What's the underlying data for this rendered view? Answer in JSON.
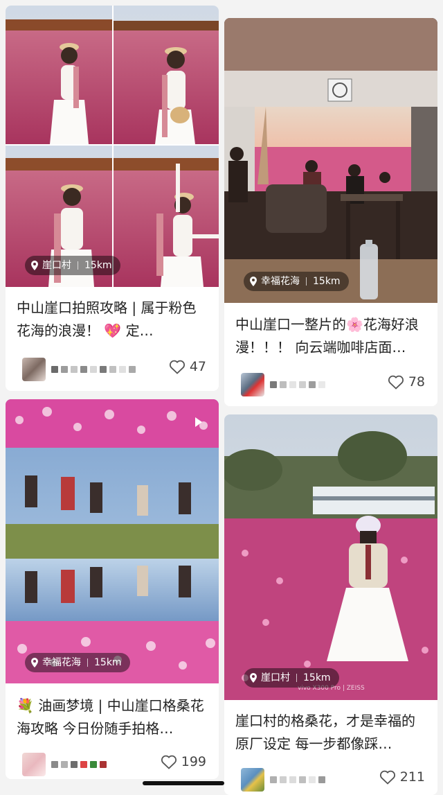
{
  "cards": [
    {
      "location": "崖口村",
      "distance": "15km",
      "title": "中山崖口拍照攻略 | 属于粉色花海的浪漫！ 💖 定…",
      "likes": "47"
    },
    {
      "location": "幸福花海",
      "distance": "15km",
      "title": "中山崖口一整片的🌸花海好浪漫！！！ 向云端咖啡店面…",
      "likes": "78"
    },
    {
      "location": "幸福花海",
      "distance": "15km",
      "title": "💐 油画梦境 | 中山崖口格桑花海攻略 今日份随手拍格…",
      "likes": "199"
    },
    {
      "location": "崖口村",
      "distance": "15km",
      "title": "崖口村的格桑花，才是幸福的原厂设定 每一步都像踩…",
      "likes": "211",
      "watermark": "vivo X300 Pro | ZEISS"
    }
  ],
  "icons": {
    "location": "location-pin-icon",
    "like": "heart-outline-icon",
    "video": "play-icon"
  },
  "colors": {
    "text": "#222222",
    "muted": "#444444",
    "pink_field": "#c8417a",
    "tag_bg": "rgba(0,0,0,0.45)"
  }
}
